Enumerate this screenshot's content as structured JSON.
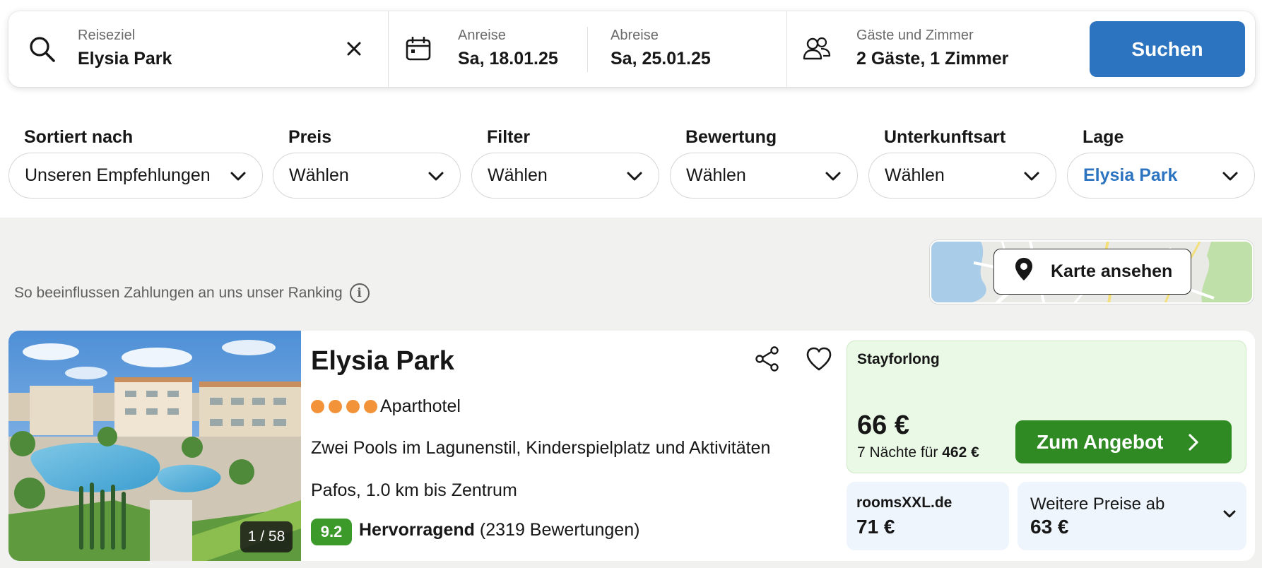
{
  "search": {
    "destination_label": "Reiseziel",
    "destination_value": "Elysia Park",
    "arrival_label": "Anreise",
    "arrival_value": "Sa, 18.01.25",
    "departure_label": "Abreise",
    "departure_value": "Sa, 25.01.25",
    "guests_label": "Gäste und Zimmer",
    "guests_value": "2 Gäste, 1 Zimmer",
    "search_button": "Suchen"
  },
  "filters": [
    {
      "label": "Sortiert nach",
      "value": "Unseren Empfehlungen"
    },
    {
      "label": "Preis",
      "value": "Wählen"
    },
    {
      "label": "Filter",
      "value": "Wählen"
    },
    {
      "label": "Bewertung",
      "value": "Wählen"
    },
    {
      "label": "Unterkunftsart",
      "value": "Wählen"
    },
    {
      "label": "Lage",
      "value": "Elysia Park"
    }
  ],
  "ranking_note": "So beeinflussen Zahlungen an uns unser Ranking",
  "map": {
    "button_label": "Karte ansehen"
  },
  "hotel": {
    "name": "Elysia Park",
    "stars": 4,
    "type": "Aparthotel",
    "description": "Zwei Pools im Lagunenstil, Kinderspielplatz und Aktivitäten",
    "location": "Pafos, 1.0 km bis Zentrum",
    "photo_counter": "1 / 58",
    "rating_score": "9.2",
    "rating_word": "Hervorragend",
    "rating_count": "(2319 Bewertungen)"
  },
  "deal": {
    "provider": "Stayforlong",
    "price": "66 €",
    "nights_text": "7 Nächte für",
    "total": "462 €",
    "button": "Zum Angebot"
  },
  "alt_offer": {
    "provider": "roomsXXL.de",
    "price": "71 €"
  },
  "more_prices": {
    "label": "Weitere Preise ab",
    "price": "63 €"
  },
  "colors": {
    "accent_blue": "#2c74c0",
    "deal_green": "#2f8a24",
    "rating_green": "#3c9a2b",
    "star_orange": "#f2933a",
    "deal_bg": "#eaf8e6"
  }
}
